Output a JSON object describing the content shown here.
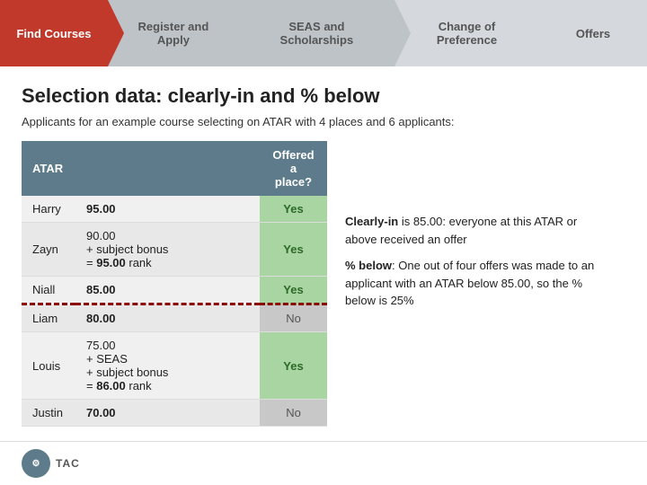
{
  "nav": {
    "items": [
      {
        "id": "find-courses",
        "label": "Find Courses",
        "state": "active"
      },
      {
        "id": "register-apply",
        "label": "Register and Apply",
        "state": "inactive"
      },
      {
        "id": "seas-scholarships",
        "label": "SEAS and Scholarships",
        "state": "inactive"
      },
      {
        "id": "change-preference",
        "label": "Change of Preference",
        "state": "light"
      },
      {
        "id": "offers",
        "label": "Offers",
        "state": "last"
      }
    ]
  },
  "page": {
    "title": "Selection data: clearly-in and % below",
    "subtitle": "Applicants for an example course selecting on ATAR with 4 places and 6 applicants:"
  },
  "table": {
    "headers": [
      "ATAR",
      "Offered a place?"
    ],
    "rows": [
      {
        "name": "Harry",
        "atar": "95.00",
        "atar_detail": "",
        "offered": "Yes",
        "offered_class": "offered-yes",
        "clearly_in": false
      },
      {
        "name": "Zayn",
        "atar": "90.00\n+ subject bonus\n= 95.00 rank",
        "atar_display": "90.00",
        "atar_extra": "+ subject bonus\n= 95.00 rank",
        "offered": "Yes",
        "offered_class": "offered-yes",
        "clearly_in": false
      },
      {
        "name": "Niall",
        "atar": "85.00",
        "atar_detail": "",
        "offered": "Yes",
        "offered_class": "offered-yes",
        "clearly_in": true
      },
      {
        "name": "Liam",
        "atar": "80.00",
        "atar_detail": "",
        "offered": "No",
        "offered_class": "offered-no",
        "clearly_in": false
      },
      {
        "name": "Louis",
        "atar": "75.00",
        "atar_extra": "+ SEAS\n+ subject bonus\n= 86.00 rank",
        "offered": "Yes",
        "offered_class": "offered-yes",
        "clearly_in": false
      },
      {
        "name": "Justin",
        "atar": "70.00",
        "atar_detail": "",
        "offered": "No",
        "offered_class": "offered-no",
        "clearly_in": false
      }
    ]
  },
  "side_info": {
    "clearly_in_text": "Clearly-in",
    "clearly_in_desc": " is 85.00: everyone at this ATAR or above received an offer",
    "percent_below_text": "% below",
    "percent_below_desc": ": One out of four offers was made to an applicant with an ATAR below 85.00, so the % below is 25%"
  },
  "footer": {
    "logo_text": "TAC",
    "brand_text": "TAC"
  }
}
